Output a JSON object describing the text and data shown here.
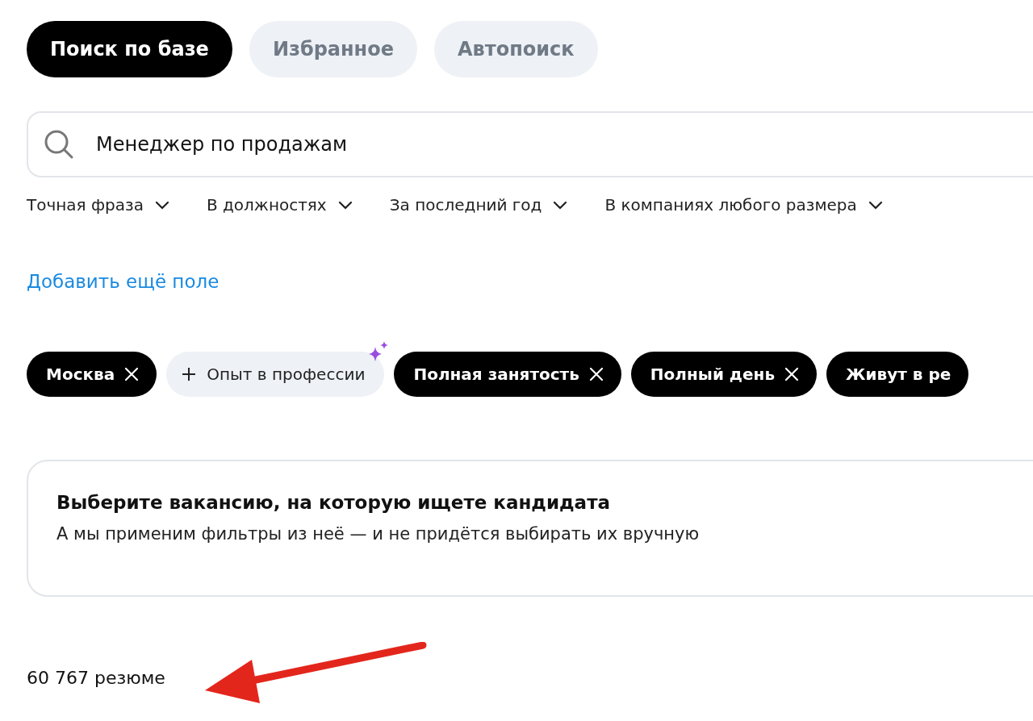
{
  "tabs": [
    {
      "label": "Поиск по базе",
      "selected": true
    },
    {
      "label": "Избранное",
      "selected": false
    },
    {
      "label": "Автопоиск",
      "selected": false
    }
  ],
  "search": {
    "value": "Менеджер по продажам"
  },
  "filters": [
    {
      "label": "Точная фраза"
    },
    {
      "label": "В должностях"
    },
    {
      "label": "За последний год"
    },
    {
      "label": "В компаниях любого размера"
    }
  ],
  "add_field_link": "Добавить ещё поле",
  "chips": [
    {
      "label": "Москва",
      "kind": "active"
    },
    {
      "label": "Опыт в профессии",
      "kind": "add"
    },
    {
      "label": "Полная занятость",
      "kind": "active"
    },
    {
      "label": "Полный день",
      "kind": "active"
    },
    {
      "label": "Живут в ре",
      "kind": "partial"
    }
  ],
  "vacancy_card": {
    "title": "Выберите вакансию, на которую ищете кандидата",
    "text": "А мы применим фильтры из неё — и не придётся выбирать их вручную"
  },
  "result_count": "60 767 резюме"
}
